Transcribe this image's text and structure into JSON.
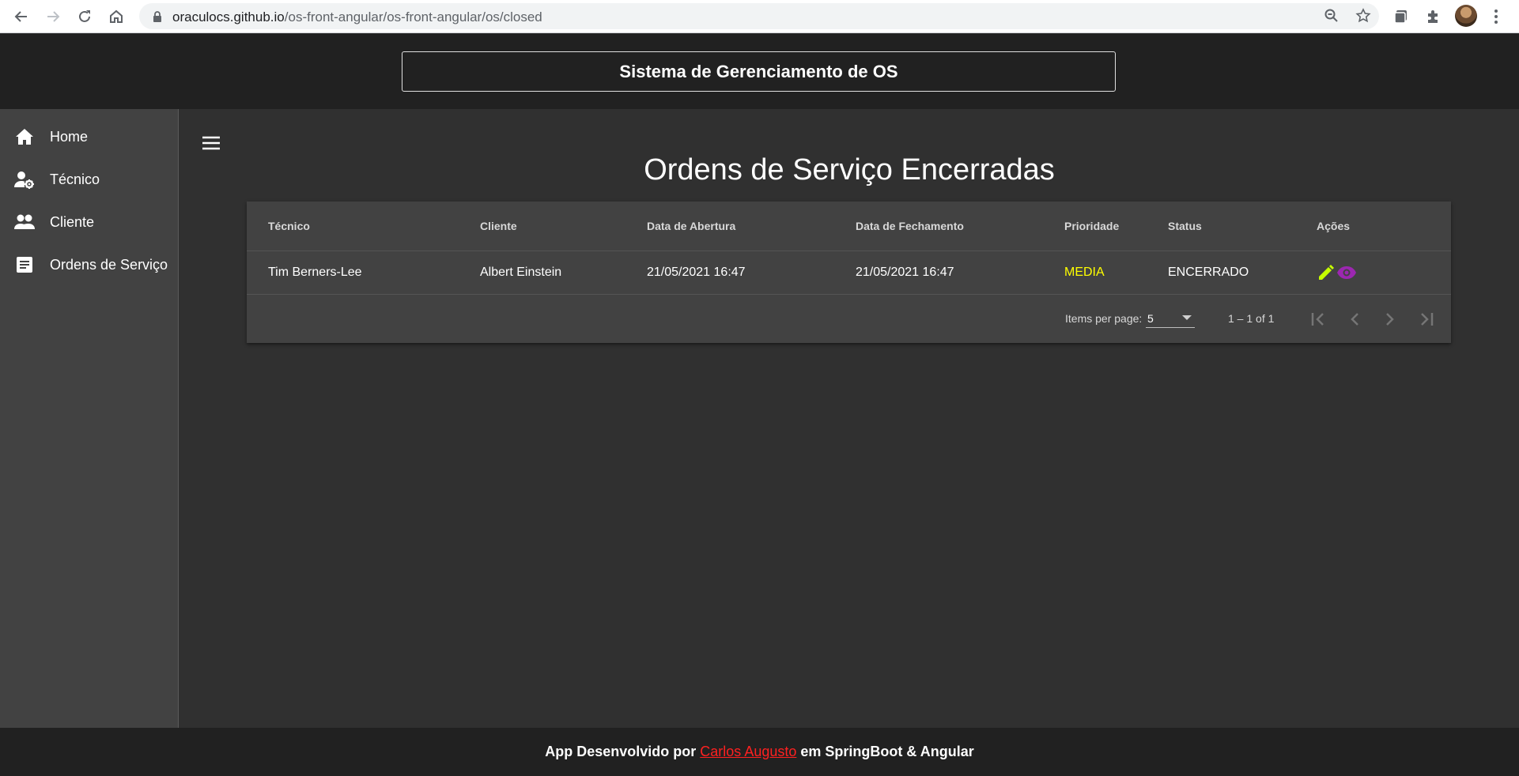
{
  "browser": {
    "url_host": "oraculocs.github.io",
    "url_path": "/os-front-angular/os-front-angular/os/closed"
  },
  "header": {
    "title": "Sistema de Gerenciamento de OS"
  },
  "sidebar": {
    "items": [
      {
        "label": "Home",
        "icon": "home-icon"
      },
      {
        "label": "Técnico",
        "icon": "person-gear-icon"
      },
      {
        "label": "Cliente",
        "icon": "people-icon"
      },
      {
        "label": "Ordens de Serviço",
        "icon": "document-icon"
      }
    ]
  },
  "main": {
    "title": "Ordens de Serviço Encerradas",
    "table": {
      "columns": [
        "Técnico",
        "Cliente",
        "Data de Abertura",
        "Data de Fechamento",
        "Prioridade",
        "Status",
        "Ações"
      ],
      "rows": [
        {
          "tecnico": "Tim Berners-Lee",
          "cliente": "Albert Einstein",
          "abertura": "21/05/2021 16:47",
          "fechamento": "21/05/2021 16:47",
          "prioridade": "MEDIA",
          "status": "ENCERRADO"
        }
      ]
    },
    "paginator": {
      "items_label": "Items per page:",
      "page_size": "5",
      "range": "1 – 1 of 1"
    }
  },
  "footer": {
    "prefix": "App Desenvolvido por",
    "author": "Carlos Augusto",
    "suffix": "em SpringBoot & Angular"
  },
  "colors": {
    "priority_media": "#ffff00",
    "edit_icon": "#c6ff00",
    "view_icon": "#9c27b0",
    "footer_link": "#ff2020"
  }
}
